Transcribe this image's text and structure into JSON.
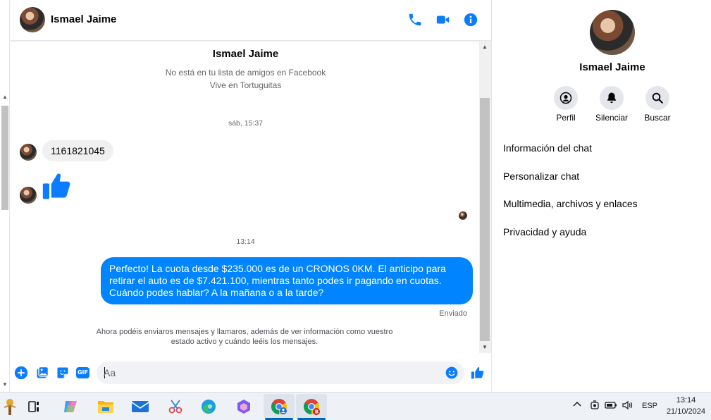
{
  "header": {
    "contact_name": "Ismael Jaime"
  },
  "intro": {
    "name": "Ismael Jaime",
    "line1": "No está en tu lista de amigos en Facebook",
    "line2": "Vive en Tortuguitas"
  },
  "messages": {
    "timestamp1": "sáb, 15:37",
    "incoming_text": "1161821045",
    "timestamp2": "13:14",
    "outgoing_text": "Perfecto! La cuota desde $235.000 es de un CRONOS 0KM. El anticipo para retirar el auto es de $7.421.100, mientras tanto podes ir pagando en cuotas. Cuándo podes hablar? A la mañana o a la tarde?",
    "status": "Enviado",
    "notice": "Ahora podéis enviaros mensajes y llamaros, además de ver información como vuestro estado activo y cuándo leéis los mensajes."
  },
  "composer": {
    "placeholder": "Aa",
    "gif_label": "GIF"
  },
  "info_panel": {
    "name": "Ismael Jaime",
    "actions": [
      {
        "label": "Perfil",
        "icon": "profile-icon"
      },
      {
        "label": "Silenciar",
        "icon": "bell-icon"
      },
      {
        "label": "Buscar",
        "icon": "search-icon"
      }
    ],
    "menu": [
      "Información del chat",
      "Personalizar chat",
      "Multimedia, archivos y enlaces",
      "Privacidad y ayuda"
    ]
  },
  "taskbar": {
    "language": "ESP",
    "time": "13:14",
    "date": "21/10/2024"
  },
  "colors": {
    "accent": "#0084ff",
    "icon_blue": "#0a7cff",
    "bubble_in": "#f0f0f0",
    "secondary_text": "#65676b"
  }
}
